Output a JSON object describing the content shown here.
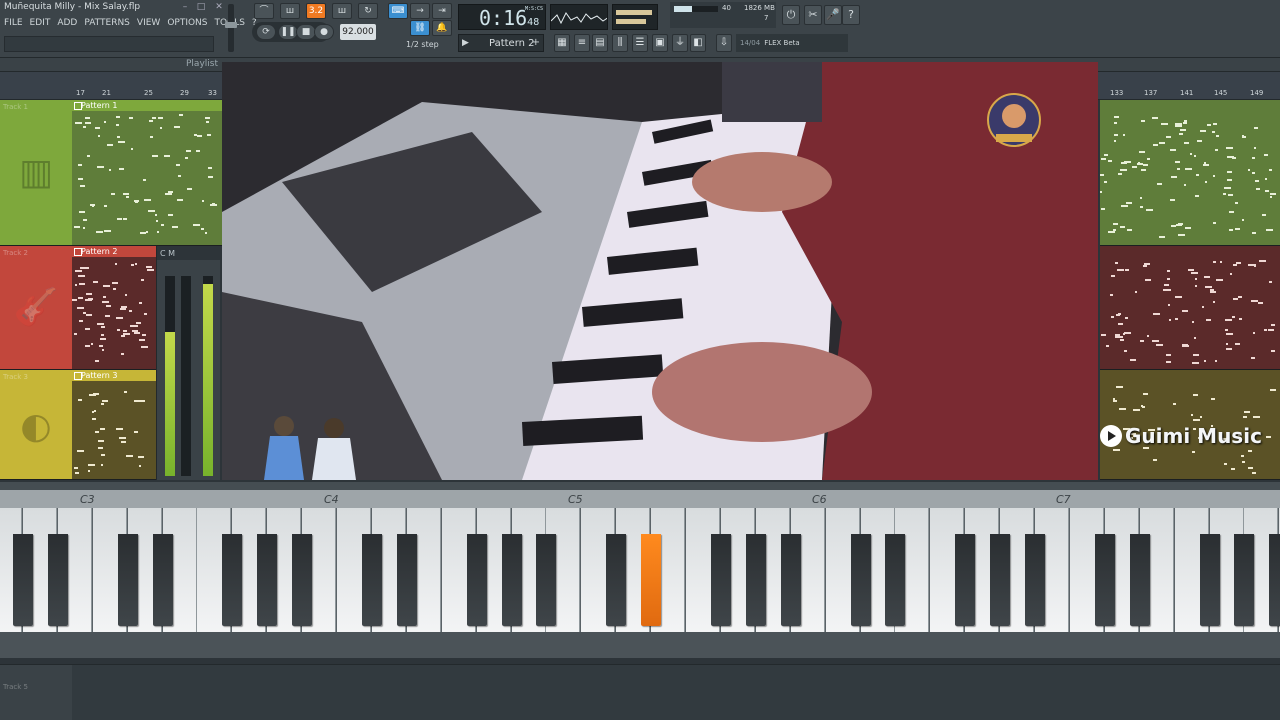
{
  "window": {
    "title": "Muñequita Milly - Mix Salay.flp"
  },
  "menu": [
    "FILE",
    "EDIT",
    "ADD",
    "PATTERNS",
    "VIEW",
    "OPTIONS",
    "TOOLS",
    "?"
  ],
  "transport": {
    "mode_label": "3.2",
    "tempo": "92.000",
    "step": "1/2 step",
    "time_main": "0:16",
    "time_sub": "48",
    "time_unit": "M:S:CS"
  },
  "meters": {
    "cpu": "40",
    "memory": "1826 MB",
    "polyphony": "7"
  },
  "pattern": {
    "selected": "Pattern 2",
    "play": "▶",
    "add": "+"
  },
  "news": {
    "date": "14/04",
    "text": "FLEX Beta"
  },
  "playlist": {
    "title": "Playlist",
    "ruler_left": [
      "17",
      "21",
      "25",
      "29",
      "33"
    ],
    "ruler_right": [
      "133",
      "137",
      "141",
      "145",
      "149"
    ],
    "tracks": [
      {
        "name": "Track 1",
        "pattern": "Pattern 1",
        "icon": "piano-icon",
        "color": "#7ea83c",
        "lane": "#5f7d3a"
      },
      {
        "name": "Track 2",
        "pattern": "Pattern 2",
        "icon": "guitar-icon",
        "color": "#c2473c",
        "lane": "#5b2a2a"
      },
      {
        "name": "Track 3",
        "pattern": "Pattern 3",
        "icon": "drum-icon",
        "color": "#c6b637",
        "lane": "#5b5226"
      }
    ],
    "track5": "Track 5"
  },
  "mixer": {
    "header": "C  M"
  },
  "video": {
    "channel": "Guimi Music"
  },
  "piano": {
    "octaves": [
      "C3",
      "C4",
      "C5",
      "C6",
      "C7"
    ],
    "pressed_color": "#f07a22"
  }
}
